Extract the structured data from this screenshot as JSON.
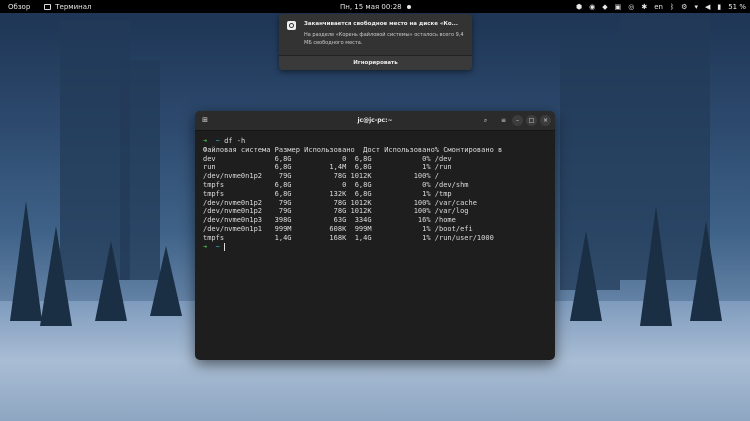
{
  "topbar": {
    "overview": "Обзор",
    "app_name": "Терминал",
    "clock": "Пн, 15 мая  00:28",
    "keyboard_layout": "en",
    "battery": "51 %"
  },
  "notification": {
    "title": "Заканчивается свободное место на диске «Ко...",
    "body": "На разделе «Корень файловой системы» осталось всего 9,4 МБ свободного места.",
    "action": "Игнорировать"
  },
  "terminal": {
    "title": "jc@jc-pc:~",
    "command": "df -h",
    "header": "Файловая система Размер Использовано  Дост Использовано% Смонтировано в",
    "rows": [
      "dev              6,8G            0  6,8G            0% /dev",
      "run              6,8G         1,4M  6,8G            1% /run",
      "/dev/nvme0n1p2    79G          78G 1012K          100% /",
      "tmpfs            6,8G            0  6,8G            0% /dev/shm",
      "tmpfs            6,8G         132K  6,8G            1% /tmp",
      "/dev/nvme0n1p2    79G          78G 1012K          100% /var/cache",
      "/dev/nvme0n1p2    79G          78G 1012K          100% /var/log",
      "/dev/nvme0n1p3   398G          63G  334G           16% /home",
      "/dev/nvme0n1p1   999M         608K  999M            1% /boot/efi",
      "tmpfs            1,4G         168K  1,4G            1% /run/user/1000"
    ]
  },
  "colors": {
    "prompt_arrow": "#46c246",
    "prompt_dir": "#3fb0c8",
    "terminal_bg": "#1e1e1e",
    "topbar_bg": "#000000"
  }
}
